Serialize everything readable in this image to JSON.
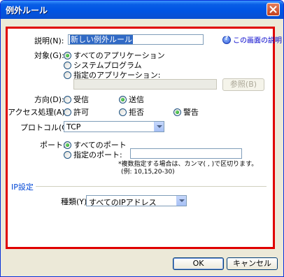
{
  "window": {
    "title": "例外ルール",
    "close_label": "×"
  },
  "help": {
    "label": "この画面の説明"
  },
  "description": {
    "label": "説明(N):",
    "value": "新しい例外ルール"
  },
  "target": {
    "label": "対象(G):",
    "options": [
      "すべてのアプリケーション",
      "システムプログラム",
      "指定のアプリケーション:"
    ],
    "selected": 0,
    "path_value": "",
    "browse_label": "参照(B)"
  },
  "direction": {
    "label": "方向(D):",
    "options": [
      "受信",
      "送信"
    ],
    "selected": 1
  },
  "access": {
    "label": "アクセス処理(A):",
    "options": [
      "許可",
      "拒否",
      "警告"
    ],
    "selected": 2
  },
  "protocol": {
    "label": "プロトコル(C):",
    "value": "TCP"
  },
  "port": {
    "label": "ポート:",
    "options": [
      "すべてのポート",
      "指定のポート:"
    ],
    "selected": 0,
    "value": "",
    "note_line1": "*複数指定する場合は、カンマ( , )で区切ります。",
    "note_line2": "(例: 10,15,20-30)"
  },
  "ip": {
    "group_title": "IP設定",
    "type_label": "種類(Y):",
    "type_value": "すべてのIPアドレス"
  },
  "footer": {
    "ok_label": "OK",
    "cancel_label": "キャンセル"
  },
  "colors": {
    "highlight_frame": "#e00000",
    "titlebar": "#0054e3",
    "group_title": "#0046d5"
  }
}
